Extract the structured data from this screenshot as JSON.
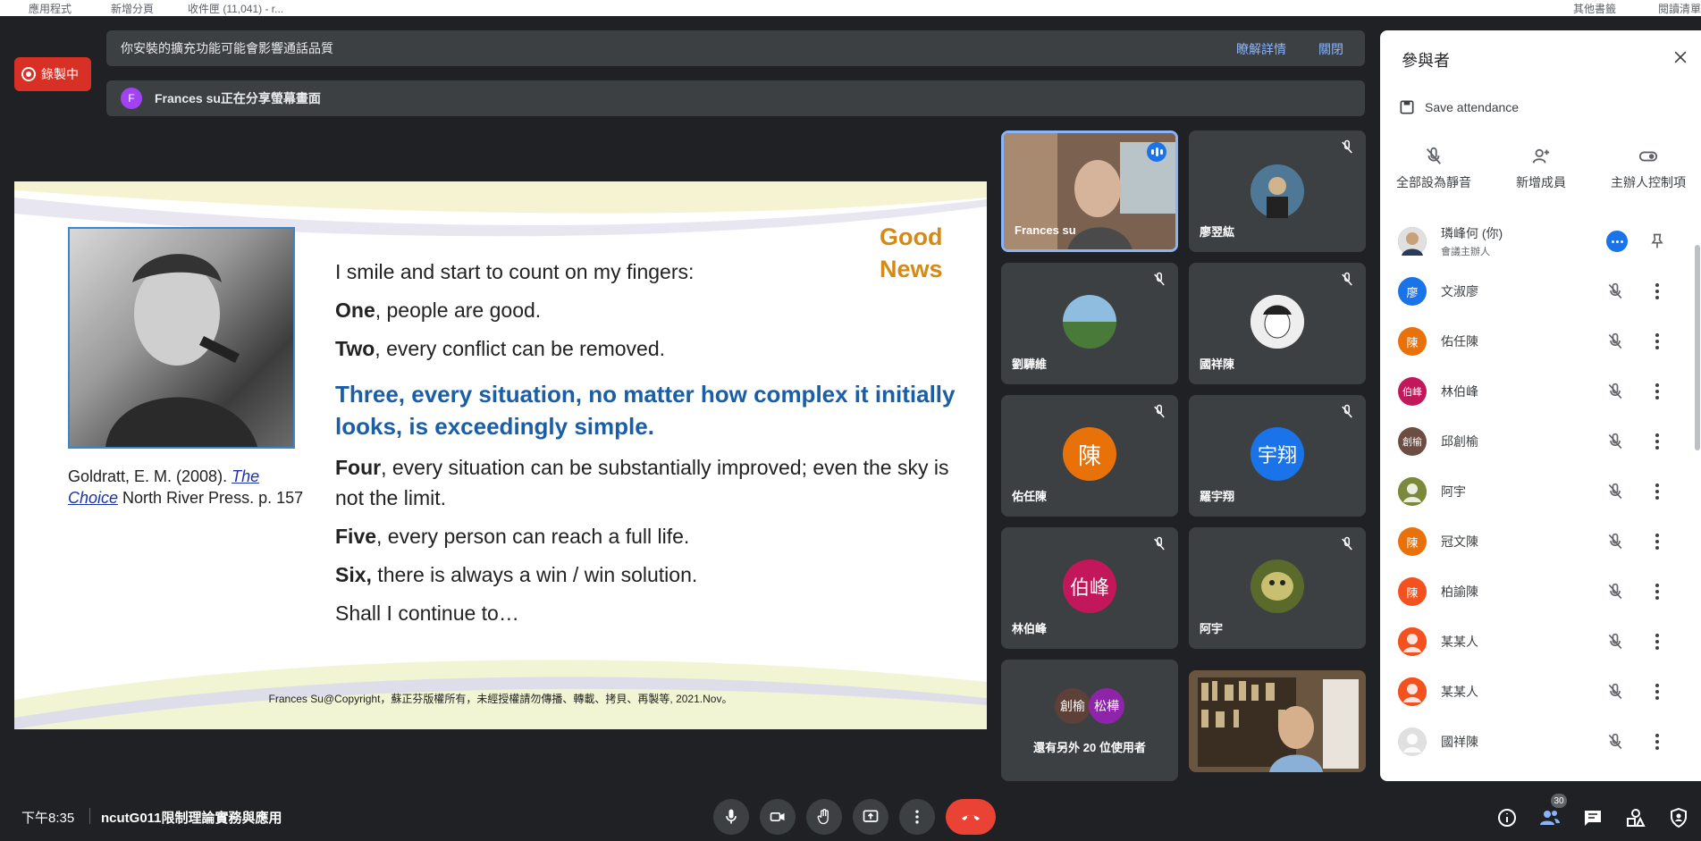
{
  "bookmarks": [
    "應用程式",
    "新增分頁",
    "收件匣 (11,041) - r...",
    "其他書籤",
    "閱讀清單"
  ],
  "recording_label": "錄製中",
  "notifications": {
    "extension_warning": "你安裝的擴充功能可能會影響通話品質",
    "learn_more": "瞭解詳情",
    "close": "關閉",
    "presenter_initial": "F",
    "presenting": "Frances su正在分享螢幕畫面"
  },
  "slide": {
    "good": "Good",
    "news": "News",
    "line1": "I smile and start to count on my fingers:",
    "one_b": "One",
    "one_rest": ", people are good.",
    "two_b": "Two",
    "two_rest": ", every conflict can be removed.",
    "three": "Three, every situation, no matter how complex it initially looks, is exceedingly simple.",
    "four_b": "Four",
    "four_rest": ", every situation can be substantially improved; even the sky is",
    "four_rest2": "not the limit.",
    "five_b": "Five",
    "five_rest": ", every person can reach a full life.",
    "six_b": "Six,",
    "six_rest": " there is always a win / win solution.",
    "shall": "Shall I continue to…",
    "caption_a": "Goldratt, E. M. (2008). ",
    "caption_title1": "The",
    "caption_title2": "Choice",
    "caption_b": " North River Press. p. 157",
    "footer": "Frances Su@Copyright，蘇正芬版權所有，未經授權請勿傳播、轉載、拷貝、再製等, 2021.Nov。"
  },
  "tiles": [
    {
      "name": "Frances su",
      "avatar": "",
      "color": "#6b5a4a"
    },
    {
      "name": "廖翌紘",
      "avatar": "",
      "color": "#4a6a80"
    },
    {
      "name": "劉驊維",
      "avatar": "",
      "color": "#5f8fb0"
    },
    {
      "name": "國祥陳",
      "avatar": "",
      "color": "#cfcfcf"
    },
    {
      "name": "佑任陳",
      "avatar": "陳",
      "color": "#e8710a"
    },
    {
      "name": "羅宇翔",
      "avatar": "宇翔",
      "color": "#1a73e8"
    },
    {
      "name": "林伯峰",
      "avatar": "伯峰",
      "color": "#c2185b"
    },
    {
      "name": "阿宇",
      "avatar": "",
      "color": "#7a8a3a"
    }
  ],
  "others": {
    "a1": "創榆",
    "a2": "松樺",
    "text": "還有另外 20 位使用者",
    "c1": "#5d4037",
    "c2": "#8e24aa"
  },
  "panel": {
    "title": "參與者",
    "save_attendance": "Save attendance",
    "mute_all": "全部設為靜音",
    "add_people": "新增成員",
    "host_controls": "主辦人控制項",
    "participants": [
      {
        "avatar": "",
        "name": "璘峰何 (你)",
        "sub": "會議主辦人",
        "color": "#5f6368"
      },
      {
        "avatar": "廖",
        "name": "文淑廖",
        "sub": "",
        "color": "#1a73e8"
      },
      {
        "avatar": "陳",
        "name": "佑任陳",
        "sub": "",
        "color": "#e8710a"
      },
      {
        "avatar": "伯峰",
        "name": "林伯峰",
        "sub": "",
        "color": "#c2185b"
      },
      {
        "avatar": "創榆",
        "name": "邱創榆",
        "sub": "",
        "color": "#6d4c41"
      },
      {
        "avatar": "",
        "name": "阿宇",
        "sub": "",
        "color": "#7a8a3a"
      },
      {
        "avatar": "陳",
        "name": "冠文陳",
        "sub": "",
        "color": "#e8710a"
      },
      {
        "avatar": "陳",
        "name": "柏諭陳",
        "sub": "",
        "color": "#f4511e"
      },
      {
        "avatar": "",
        "name": "某某人",
        "sub": "",
        "color": "#f4511e"
      },
      {
        "avatar": "",
        "name": "某某人",
        "sub": "",
        "color": "#f4511e"
      },
      {
        "avatar": "",
        "name": "國祥陳",
        "sub": "",
        "color": "#e0e0e0"
      }
    ]
  },
  "bottom": {
    "time": "下午8:35",
    "meeting_name": "ncutG011限制理論實務與應用",
    "participant_count": "30"
  },
  "colors": {
    "background": "#202124",
    "accent": "#8ab4f8",
    "end_call": "#ea4335",
    "recording": "#d93025"
  }
}
